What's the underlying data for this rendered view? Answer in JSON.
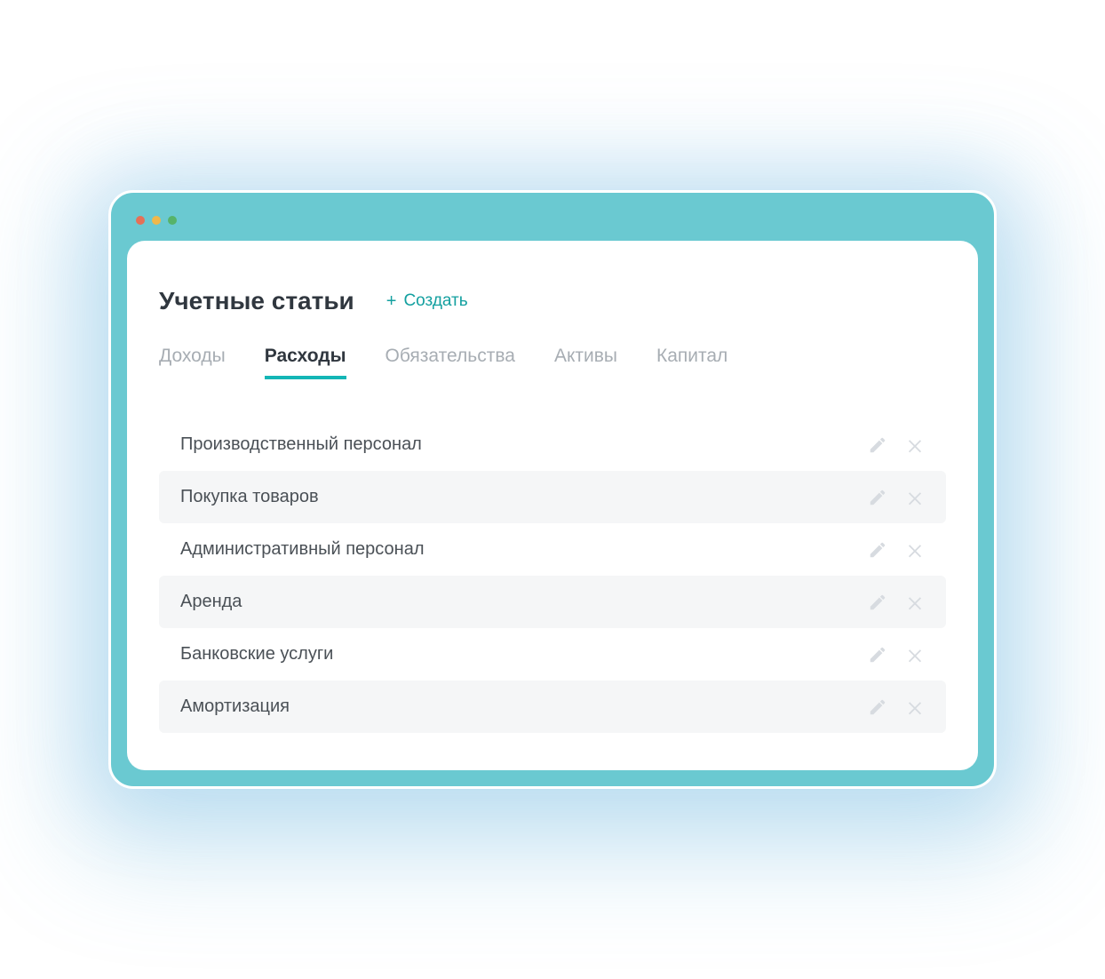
{
  "header": {
    "title": "Учетные статьи",
    "create_label": "Создать"
  },
  "tabs": [
    {
      "label": "Доходы",
      "active": false
    },
    {
      "label": "Расходы",
      "active": true
    },
    {
      "label": "Обязательства",
      "active": false
    },
    {
      "label": "Активы",
      "active": false
    },
    {
      "label": "Капитал",
      "active": false
    }
  ],
  "items": [
    {
      "label": "Производственный персонал"
    },
    {
      "label": "Покупка товаров"
    },
    {
      "label": "Административный персонал"
    },
    {
      "label": "Аренда"
    },
    {
      "label": "Банковские услуги"
    },
    {
      "label": "Амортизация"
    }
  ]
}
